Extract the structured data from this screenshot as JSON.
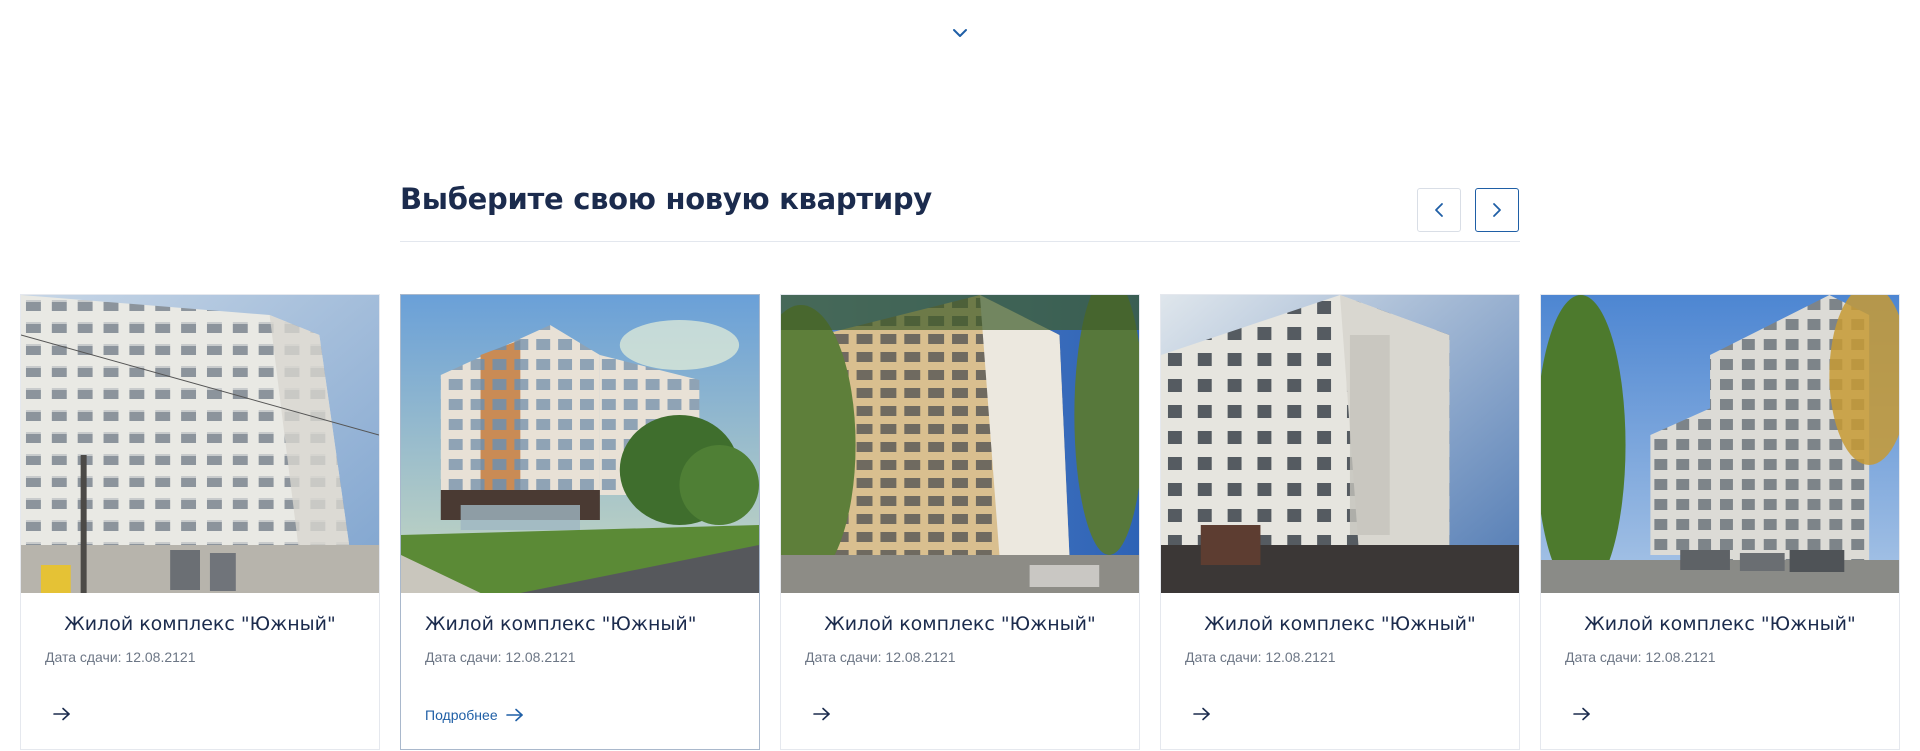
{
  "section": {
    "title": "Выберите свою новую квартиру"
  },
  "colors": {
    "accent": "#1f5fa6",
    "title": "#1b2b4d",
    "muted": "#6c7685",
    "divider": "#e3e7ee"
  },
  "icons": {
    "scroll_down": "chevron-down-icon",
    "prev": "chevron-left-icon",
    "next": "chevron-right-icon",
    "more": "arrow-right-icon"
  },
  "cards": [
    {
      "title": "Жилой комплекс \"Южный\"",
      "date": "Дата сдачи: 12.08.2121",
      "more_label": ""
    },
    {
      "title": "Жилой комплекс \"Южный\"",
      "date": "Дата сдачи: 12.08.2121",
      "more_label": "Подробнее"
    },
    {
      "title": "Жилой комплекс \"Южный\"",
      "date": "Дата сдачи: 12.08.2121",
      "more_label": ""
    },
    {
      "title": "Жилой комплекс \"Южный\"",
      "date": "Дата сдачи: 12.08.2121",
      "more_label": ""
    },
    {
      "title": "Жилой комплекс \"Южный\"",
      "date": "Дата сдачи: 12.08.2121",
      "more_label": ""
    }
  ]
}
